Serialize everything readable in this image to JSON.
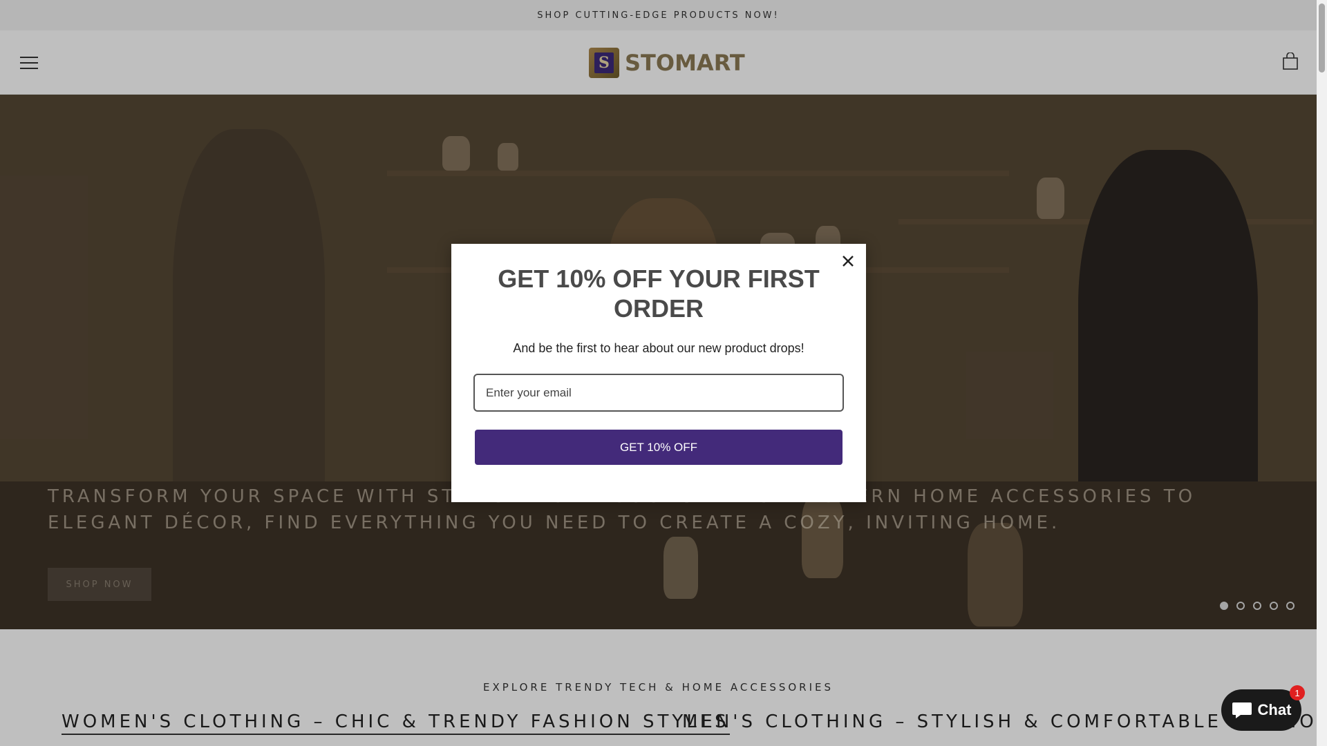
{
  "announcement": {
    "text": "SHOP CUTTING-EDGE PRODUCTS NOW!"
  },
  "header": {
    "logo_text": "STOMART",
    "logo_mark": "S",
    "menu_icon": "hamburger-menu-icon",
    "cart_icon": "shopping-bag-icon"
  },
  "hero": {
    "text": "TRANSFORM YOUR SPACE WITH STYLISH HOME GOODS – FROM MODERN HOME ACCESSORIES TO ELEGANT DÉCOR, FIND EVERYTHING YOU NEED TO CREATE A COZY, INVITING HOME.",
    "button": "SHOP NOW",
    "slides_total": 5,
    "active_slide": 1
  },
  "popup": {
    "title": "GET 10% OFF YOUR FIRST ORDER",
    "subtitle": "And be the first to hear about our new product drops!",
    "email_placeholder": "Enter your email",
    "button": "GET 10% OFF",
    "close_icon": "close-icon",
    "button_color": "#432a7a"
  },
  "collections": {
    "heading": "EXPLORE TRENDY TECH & HOME ACCESSORIES",
    "tabs": [
      {
        "label": "WOMEN'S CLOTHING – CHIC & TRENDY FASHION STYLES",
        "active": true
      },
      {
        "label": "MEN'S CLOTHING – STYLISH & COMFORTABLE FASHION",
        "active": false
      }
    ]
  },
  "chat": {
    "label": "Chat",
    "badge": "1",
    "icon": "chat-bubble-icon"
  }
}
